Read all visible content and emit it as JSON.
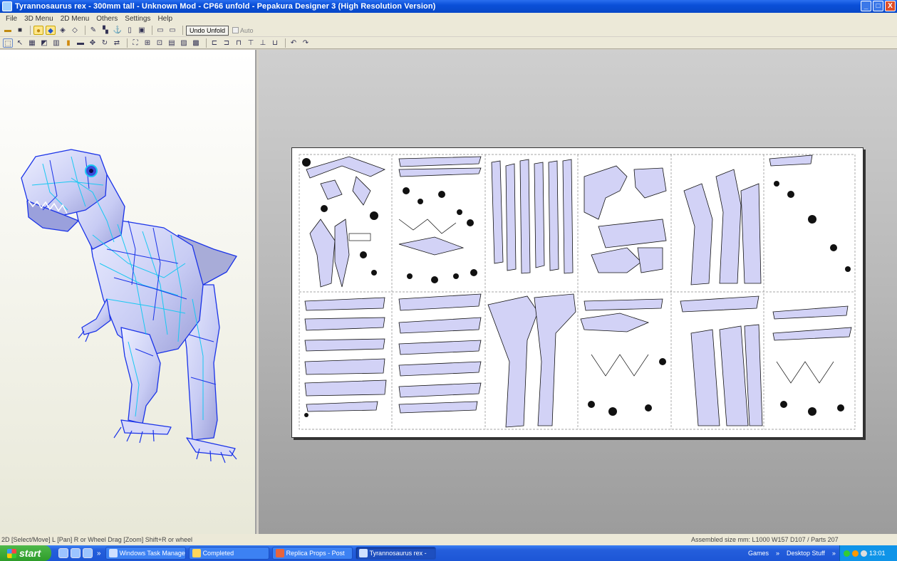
{
  "window": {
    "title": "Tyrannosaurus rex - 300mm tall - Unknown Mod - CP66 unfold - Pepakura Designer 3 (High Resolution Version)",
    "controls": [
      "_",
      "□",
      "X"
    ]
  },
  "menu": [
    "File",
    "3D Menu",
    "2D Menu",
    "Others",
    "Settings",
    "Help"
  ],
  "toolbar": {
    "undo_unfold_label": "Undo Unfold",
    "auto_label": "Auto"
  },
  "status": {
    "left": "2D [Select/Move] L [Pan] R or Wheel Drag [Zoom] Shift+R or wheel",
    "right": "Assembled size mm: L1000 W157 D107 / Parts 207"
  },
  "taskbar": {
    "start_label": "start",
    "tasks": [
      {
        "label": "Windows Task Manager",
        "active": false
      },
      {
        "label": "Completed",
        "active": false
      },
      {
        "label": "Replica Props - Post",
        "active": false
      },
      {
        "label": "Tyrannosaurus rex -",
        "active": true
      }
    ],
    "links": [
      "Games",
      "Desktop Stuff"
    ],
    "clock": "13:01"
  },
  "colors": {
    "part_fill": "#d2d2f6",
    "mesh_blue": "#1a33e8",
    "mesh_cyan": "#19c8f2"
  }
}
